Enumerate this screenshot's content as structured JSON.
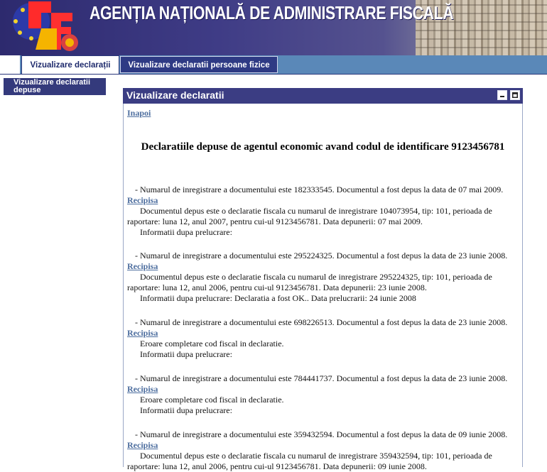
{
  "header": {
    "title": "AGENȚIA NAȚIONALĂ DE ADMINISTRARE FISCALĂ",
    "colors": {
      "banner": "#2d2a6e",
      "tab_bar": "#5a88b8",
      "panel_header": "#3b3d83",
      "link": "#4c6d9e"
    }
  },
  "tabs": [
    {
      "label": "Vizualizare declarații",
      "active": true
    },
    {
      "label": "Vizualizare declaratii persoane fizice",
      "active": false
    }
  ],
  "sidebar": {
    "item": "Vizualizare declaratii depuse"
  },
  "panel": {
    "title": "Vizualizare declaratii",
    "back_link": "Inapoi",
    "heading": "Declaratiile depuse de agentul economic avand codul de identificare 9123456781",
    "minimize_icon": "minimize-icon",
    "maximize_icon": "maximize-icon"
  },
  "entries": [
    {
      "line1": "- Numarul de inregistrare a documentului este 182333545. Documentul a fost depus la data de 07 mai 2009.",
      "receipt": "Recipisa",
      "detail": "Documentul depus este o declaratie fiscala cu numarul de inregistrare 104073954, tip: 101, perioada de raportare: luna 12, anul 2007, pentru cui-ul 9123456781. Data depunerii: 07 mai 2009.",
      "info": "Informatii dupa prelucrare:"
    },
    {
      "line1": "- Numarul de inregistrare a documentului este 295224325. Documentul a fost depus la data de 23 iunie 2008.",
      "receipt": "Recipisa",
      "detail": "Documentul depus este o declaratie fiscala cu numarul de inregistrare 295224325, tip: 101, perioada de raportare: luna 12, anul 2006, pentru cui-ul 9123456781. Data depunerii: 23 iunie 2008.",
      "info": "Informatii dupa prelucrare: Declaratia a fost OK.. Data prelucrarii: 24 iunie 2008"
    },
    {
      "line1": "- Numarul de inregistrare a documentului este 698226513. Documentul a fost depus la data de 23 iunie 2008.",
      "receipt": "Recipisa",
      "detail": "Eroare completare cod fiscal in declaratie.",
      "info": "Informatii dupa prelucrare:"
    },
    {
      "line1": "- Numarul de inregistrare a documentului este 784441737. Documentul a fost depus la data de 23 iunie 2008.",
      "receipt": "Recipisa",
      "detail": "Eroare completare cod fiscal in declaratie.",
      "info": "Informatii dupa prelucrare:"
    },
    {
      "line1": "- Numarul de inregistrare a documentului este 359432594. Documentul a fost depus la data de 09 iunie 2008.",
      "receipt": "Recipisa",
      "detail": "Documentul depus este o declaratie fiscala cu numarul de inregistrare 359432594, tip: 101, perioada de raportare: luna 12, anul 2006, pentru cui-ul 9123456781. Data depunerii: 09 iunie 2008.",
      "info": ""
    }
  ]
}
